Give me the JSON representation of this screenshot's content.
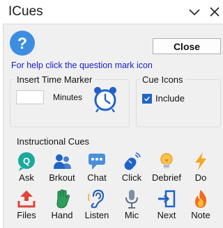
{
  "window": {
    "title": "ICues"
  },
  "header": {
    "close_label": "Close",
    "help_text": "For help click the question mark icon",
    "help_icon_glyph": "?"
  },
  "timer": {
    "group_label": "Insert Time Marker",
    "minutes_value": "",
    "minutes_label": "Minutes"
  },
  "cue_icons": {
    "group_label": "Cue Icons",
    "include_label": "Include",
    "include_checked": true
  },
  "instructional": {
    "group_label": "Instructional Cues",
    "row1": [
      {
        "label": "Ask",
        "icon": "ask-icon"
      },
      {
        "label": "Brkout",
        "icon": "breakout-icon"
      },
      {
        "label": "Chat",
        "icon": "chat-icon"
      },
      {
        "label": "Click",
        "icon": "mouse-icon"
      },
      {
        "label": "Debrief",
        "icon": "lightbulb-icon"
      },
      {
        "label": "Do",
        "icon": "lightning-icon"
      }
    ],
    "row2": [
      {
        "label": "Files",
        "icon": "upload-icon"
      },
      {
        "label": "Hand",
        "icon": "hand-icon"
      },
      {
        "label": "Listen",
        "icon": "ear-icon"
      },
      {
        "label": "Mic",
        "icon": "microphone-icon"
      },
      {
        "label": "Next",
        "icon": "next-icon"
      },
      {
        "label": "Note",
        "icon": "flame-icon"
      }
    ]
  },
  "colors": {
    "accent_blue": "#1f63c6",
    "help_circle": "#3d8ee0",
    "ask_teal": "#1aa99a",
    "files_red": "#e0443a",
    "hand_green": "#2e9e5a",
    "bulb_orange": "#f0a030",
    "bolt_orange": "#f5a623",
    "flame_orange": "#f26b1d"
  }
}
